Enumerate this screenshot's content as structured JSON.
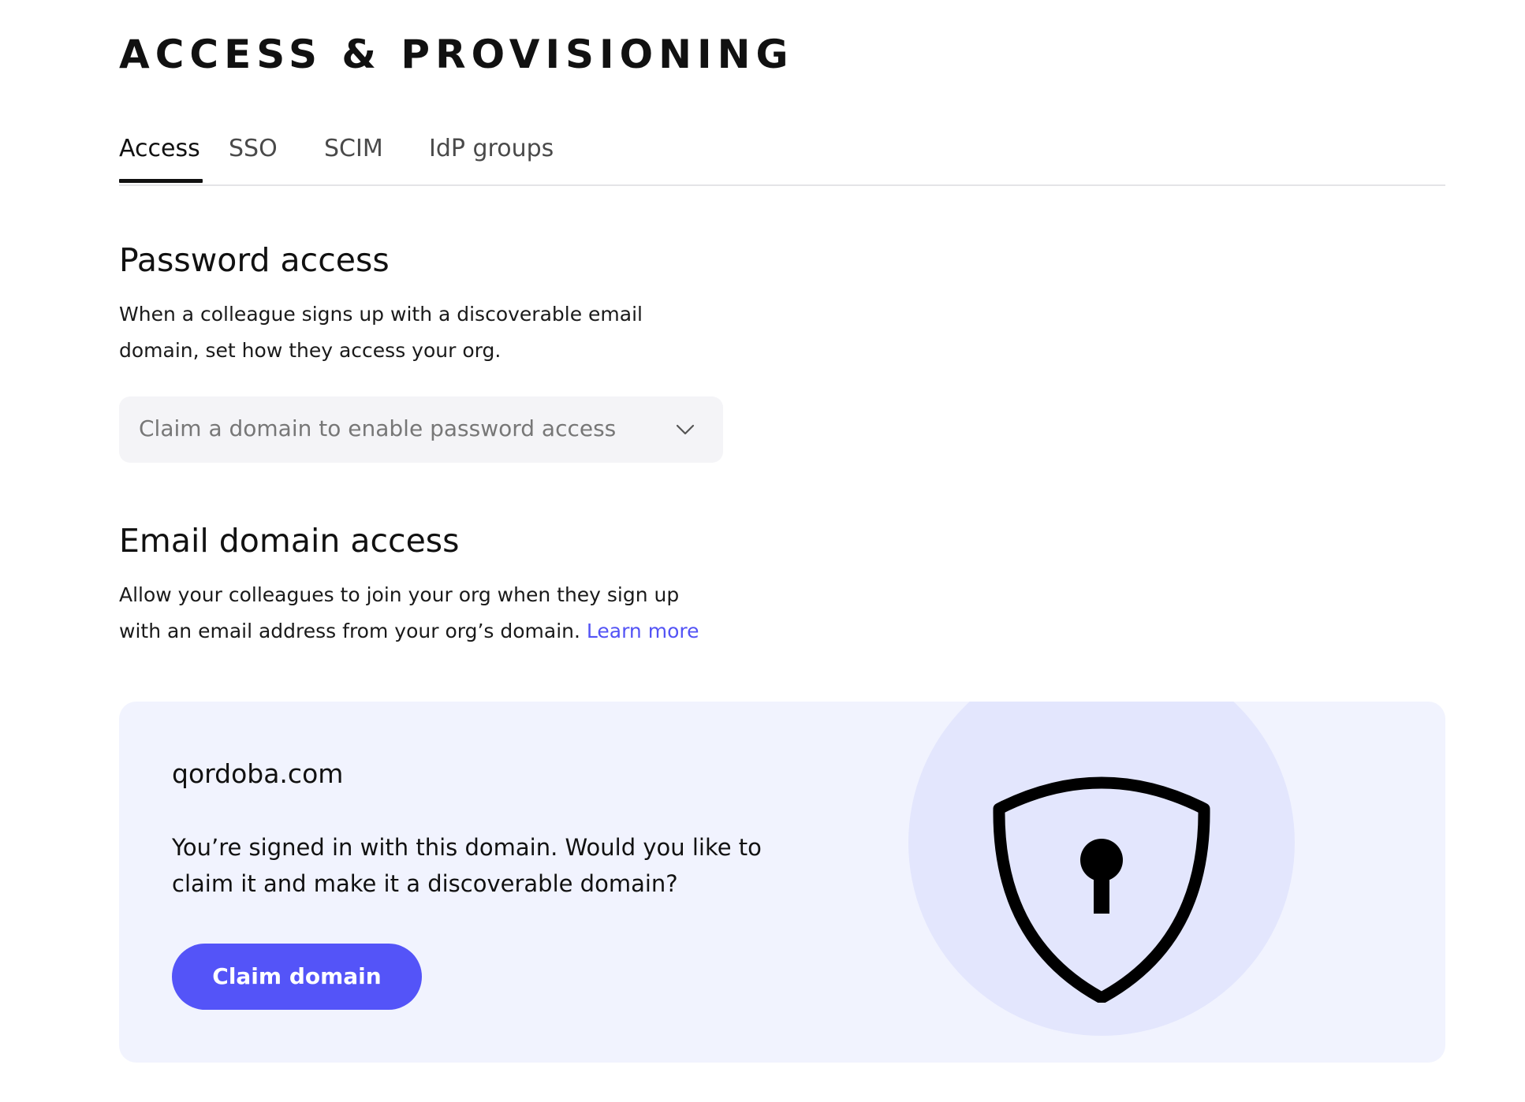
{
  "page": {
    "title": "ACCESS & PROVISIONING"
  },
  "tabs": [
    {
      "label": "Access",
      "active": true
    },
    {
      "label": "SSO",
      "active": false
    },
    {
      "label": "SCIM",
      "active": false
    },
    {
      "label": "IdP groups",
      "active": false
    }
  ],
  "password_access": {
    "title": "Password access",
    "description": "When a colleague signs up with a discoverable email domain, set how they access your org.",
    "select_value": "Claim a domain to enable password access",
    "select_icon": "chevron-down-icon"
  },
  "email_domain_access": {
    "title": "Email domain access",
    "description": "Allow your colleagues to join your org when they sign up with an email address from your org’s domain.",
    "learn_more_label": "Learn more"
  },
  "domain_card": {
    "domain": "qordoba.com",
    "message": "You’re signed in with this domain. Would you like to claim it and make it a discoverable domain?",
    "button_label": "Claim domain",
    "illustration_icon": "shield-keyhole-icon"
  },
  "colors": {
    "accent": "#5454f8",
    "link": "#5353f5",
    "card_background": "#f1f3fe",
    "illustration_circle": "#e3e6fd",
    "select_background": "#f4f4f7"
  }
}
